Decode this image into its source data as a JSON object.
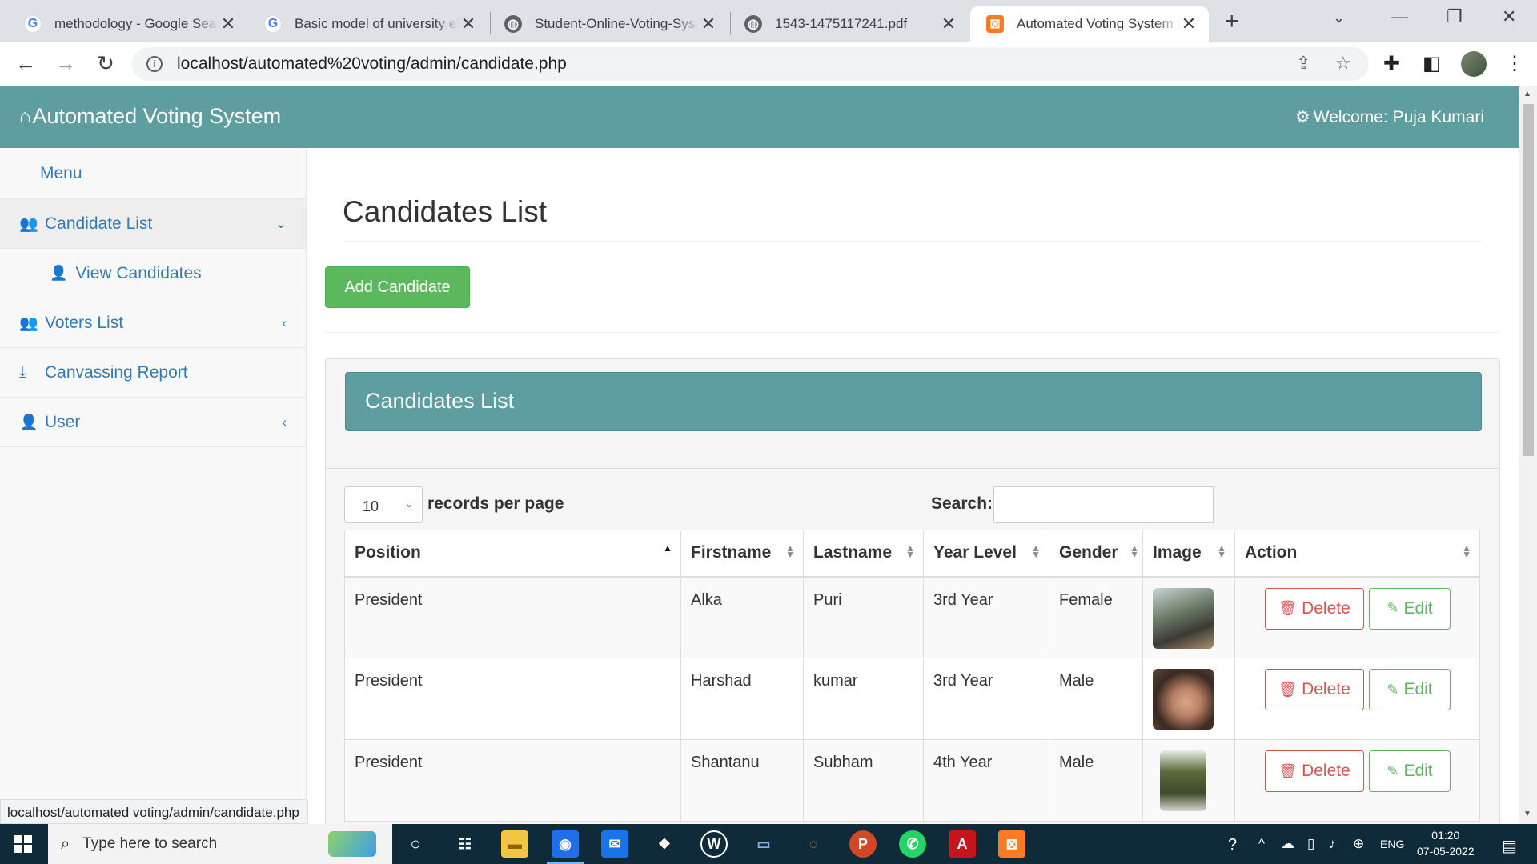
{
  "browser": {
    "tabs": [
      {
        "title": "methodology - Google Sea",
        "icon": "google-icon"
      },
      {
        "title": "Basic model of university el",
        "icon": "google-icon"
      },
      {
        "title": "Student-Online-Voting-Sys",
        "icon": "globe-icon"
      },
      {
        "title": "1543-1475117241.pdf",
        "icon": "globe-icon"
      },
      {
        "title": "Automated Voting System |",
        "icon": "xampp-icon",
        "active": true
      }
    ],
    "url": "localhost/automated%20voting/admin/candidate.php",
    "status_url": "localhost/automated voting/admin/candidate.php"
  },
  "navbar": {
    "brand": "Automated Voting System",
    "welcome": "Welcome: Puja Kumari"
  },
  "sidebar": {
    "menu_title": "Menu",
    "items": [
      {
        "label": "Candidate List",
        "icon": "users-icon"
      },
      {
        "label": "View Candidates",
        "icon": "user-icon"
      },
      {
        "label": "Voters List",
        "icon": "users-icon"
      },
      {
        "label": "Canvassing Report",
        "icon": "download-icon"
      },
      {
        "label": "User",
        "icon": "user-icon"
      }
    ]
  },
  "main": {
    "page_title": "Candidates List",
    "add_button": "Add Candidate",
    "panel_title": "Candidates List",
    "records_per_page_value": "10",
    "records_per_page_label": "records per page",
    "search_label": "Search:",
    "search_value": "",
    "columns": [
      "Position",
      "Firstname",
      "Lastname",
      "Year Level",
      "Gender",
      "Image",
      "Action"
    ],
    "rows": [
      {
        "position": "President",
        "firstname": "Alka",
        "lastname": "Puri",
        "year": "3rd Year",
        "gender": "Female"
      },
      {
        "position": "President",
        "firstname": "Harshad",
        "lastname": "kumar",
        "year": "3rd Year",
        "gender": "Male"
      },
      {
        "position": "President",
        "firstname": "Shantanu",
        "lastname": "Subham",
        "year": "4th Year",
        "gender": "Male"
      }
    ],
    "delete_label": "Delete",
    "edit_label": "Edit"
  },
  "taskbar": {
    "search_placeholder": "Type here to search",
    "language": "ENG",
    "time": "01:20",
    "date": "07-05-2022"
  },
  "colors": {
    "accent": "#5f9ea0",
    "success": "#5cb85c",
    "danger": "#d9534f",
    "link": "#337ab7"
  }
}
